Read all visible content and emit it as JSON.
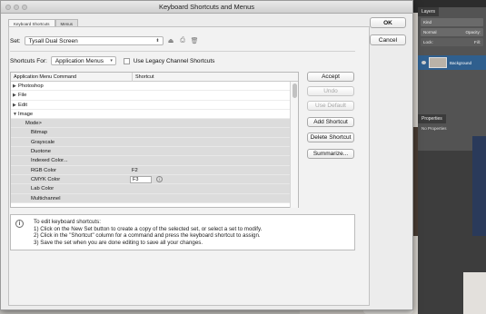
{
  "window_title": "Keyboard Shortcuts and Menus",
  "tabs": [
    "Keyboard Shortcuts",
    "Menus"
  ],
  "set": {
    "label": "Set:",
    "value": "Tysall Dual Screen"
  },
  "shortcuts_for": {
    "label": "Shortcuts For:",
    "value": "Application Menus",
    "legacy_checkbox_label": "Use Legacy Channel Shortcuts",
    "legacy_checked": false
  },
  "table": {
    "headers": [
      "Application Menu Command",
      "Shortcut"
    ],
    "rows": [
      {
        "indent": 0,
        "toggle": "collapsed",
        "name": "Photoshop",
        "shortcut": ""
      },
      {
        "indent": 0,
        "toggle": "collapsed",
        "name": "File",
        "shortcut": ""
      },
      {
        "indent": 0,
        "toggle": "collapsed",
        "name": "Edit",
        "shortcut": ""
      },
      {
        "indent": 0,
        "toggle": "expanded",
        "name": "Image",
        "shortcut": ""
      },
      {
        "indent": 1,
        "toggle": "",
        "name": "Mode>",
        "shortcut": ""
      },
      {
        "indent": 2,
        "toggle": "",
        "name": "Bitmap",
        "shortcut": ""
      },
      {
        "indent": 2,
        "toggle": "",
        "name": "Grayscale",
        "shortcut": ""
      },
      {
        "indent": 2,
        "toggle": "",
        "name": "Duotone",
        "shortcut": ""
      },
      {
        "indent": 2,
        "toggle": "",
        "name": "Indexed Color...",
        "shortcut": ""
      },
      {
        "indent": 2,
        "toggle": "",
        "name": "RGB Color",
        "shortcut": "F2"
      },
      {
        "indent": 2,
        "toggle": "",
        "name": "CMYK Color",
        "shortcut": "F3",
        "editing": true
      },
      {
        "indent": 2,
        "toggle": "",
        "name": "Lab Color",
        "shortcut": ""
      },
      {
        "indent": 2,
        "toggle": "",
        "name": "Multichannel",
        "shortcut": ""
      }
    ]
  },
  "side_buttons": {
    "accept": "Accept",
    "undo": "Undo",
    "use_default": "Use Default",
    "add_shortcut": "Add Shortcut",
    "delete_shortcut": "Delete Shortcut",
    "summarize": "Summarize..."
  },
  "dialog_buttons": {
    "ok": "OK",
    "cancel": "Cancel"
  },
  "info": {
    "lines": [
      "To edit keyboard shortcuts:",
      "1) Click on the New Set button to create a copy of the selected set, or select a set to modify.",
      "2) Click in the \"Shortcut\" column for a command and press the keyboard shortcut to assign.",
      "3) Save the set when you are done editing to save all your changes."
    ]
  },
  "panels": {
    "layers": {
      "tab": "Layers",
      "kind": "Kind",
      "blend": "Normal",
      "opacity": "Opacity:",
      "lock": "Lock:",
      "fill": "Fill:",
      "layer_name": "Background"
    },
    "properties": {
      "tab": "Properties",
      "text": "No Properties"
    }
  },
  "colors": {
    "accent": "#2f5f8e",
    "dialog_bg": "#ececec",
    "shaded_row": "#dcdcdc"
  }
}
